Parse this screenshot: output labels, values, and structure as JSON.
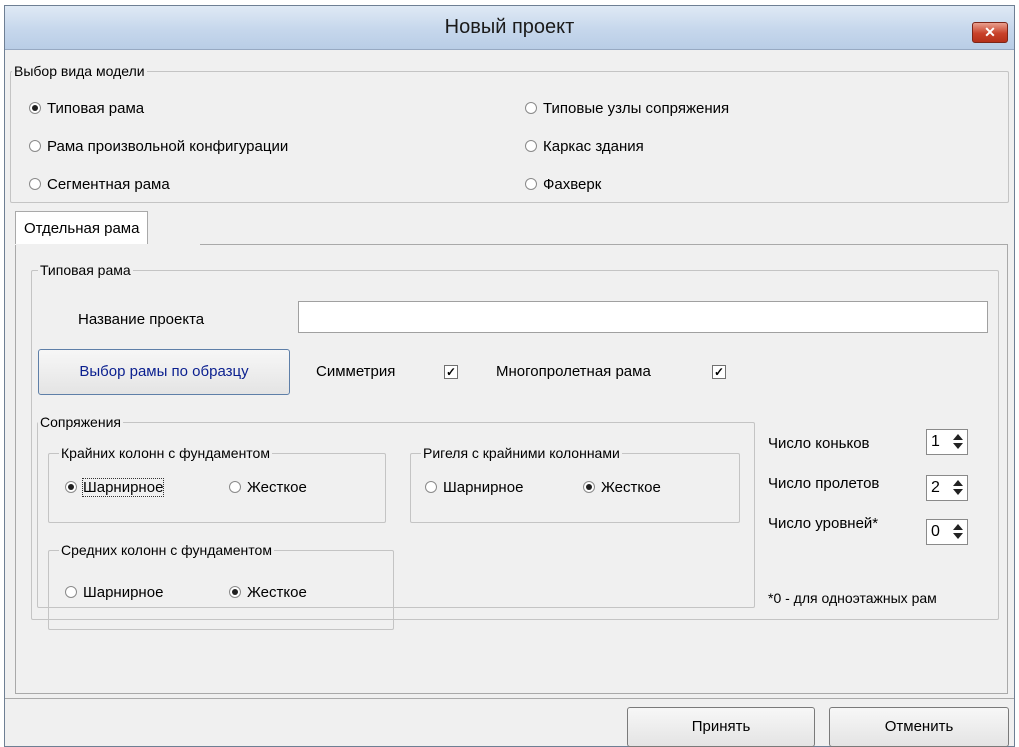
{
  "window": {
    "title": "Новый проект",
    "close_label": "✕"
  },
  "model_type": {
    "legend": "Выбор вида модели",
    "options": [
      {
        "label": "Типовая рама",
        "selected": true
      },
      {
        "label": "Рама произвольной конфигурации",
        "selected": false
      },
      {
        "label": "Сегментная рама",
        "selected": false
      },
      {
        "label": "Типовые узлы сопряжения",
        "selected": false
      },
      {
        "label": "Каркас здания",
        "selected": false
      },
      {
        "label": "Фахверк",
        "selected": false
      }
    ]
  },
  "tabs": [
    {
      "label": "Отдельная рама",
      "active": true
    }
  ],
  "frame": {
    "legend": "Типовая рама",
    "project_name_label": "Название проекта",
    "project_name_value": "",
    "select_frame_button": "Выбор рамы по образцу",
    "symmetry_label": "Симметрия",
    "symmetry_checked": true,
    "multispan_label": "Многопролетная рама",
    "multispan_checked": true
  },
  "joints": {
    "legend": "Сопряжения",
    "outer_columns": {
      "legend": "Крайних колонн с фундаментом",
      "options": [
        {
          "label": "Шарнирное",
          "selected": true
        },
        {
          "label": "Жесткое",
          "selected": false
        }
      ]
    },
    "beams": {
      "legend": "Ригеля с крайними колоннами",
      "options": [
        {
          "label": "Шарнирное",
          "selected": false
        },
        {
          "label": "Жесткое",
          "selected": true
        }
      ]
    },
    "middle_columns": {
      "legend": "Средних колонн с фундаментом",
      "options": [
        {
          "label": "Шарнирное",
          "selected": false
        },
        {
          "label": "Жесткое",
          "selected": true
        }
      ]
    }
  },
  "counts": {
    "ridges_label": "Число коньков",
    "ridges_value": "1",
    "spans_label": "Число пролетов",
    "spans_value": "2",
    "levels_label": "Число уровней*",
    "levels_value": "0",
    "footnote": "*0 - для одноэтажных рам"
  },
  "footer": {
    "accept_label": "Принять",
    "cancel_label": "Отменить"
  }
}
